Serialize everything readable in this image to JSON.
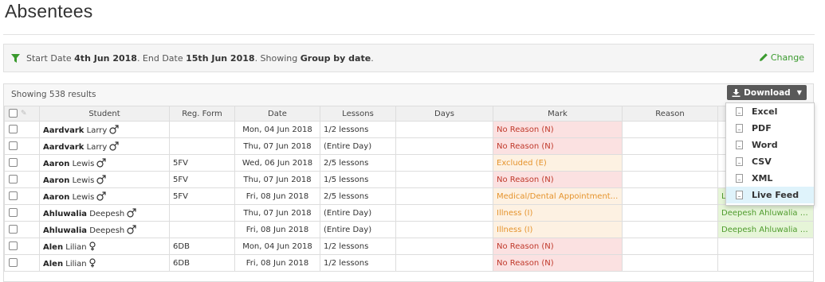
{
  "page": {
    "title": "Absentees"
  },
  "filter": {
    "prefix": "Start Date ",
    "start_date": "4th Jun 2018",
    "mid": ". End Date ",
    "end_date": "15th Jun 2018",
    "mid2": ". Showing ",
    "grouping": "Group by date",
    "suffix": ".",
    "change_label": "Change"
  },
  "results": {
    "label": "Showing 538 results"
  },
  "download": {
    "label": "Download",
    "items": [
      {
        "label": "Excel",
        "icon": "excel-file-icon"
      },
      {
        "label": "PDF",
        "icon": "pdf-file-icon"
      },
      {
        "label": "Word",
        "icon": "word-file-icon"
      },
      {
        "label": "CSV",
        "icon": "csv-file-icon"
      },
      {
        "label": "XML",
        "icon": "xml-file-icon"
      },
      {
        "label": "Live Feed",
        "icon": "live-feed-icon"
      }
    ]
  },
  "table": {
    "headers": [
      "Student",
      "Reg. Form",
      "Date",
      "Lessons",
      "Days",
      "Mark",
      "Reason"
    ],
    "rows": [
      {
        "last": "Aardvark",
        "first": "Larry",
        "gender": "male",
        "form": "",
        "date": "Mon, 04 Jun 2018",
        "lessons": "1/2 lessons",
        "days": "",
        "mark": "No Reason (N)",
        "mark_type": "red",
        "reason": "",
        "extra": ""
      },
      {
        "last": "Aardvark",
        "first": "Larry",
        "gender": "male",
        "form": "",
        "date": "Thu, 07 Jun 2018",
        "lessons": "(Entire Day)",
        "days": "",
        "mark": "No Reason (N)",
        "mark_type": "red",
        "reason": "",
        "extra": ""
      },
      {
        "last": "Aaron",
        "first": "Lewis",
        "gender": "male",
        "form": "5FV",
        "date": "Wed, 06 Jun 2018",
        "lessons": "2/5 lessons",
        "days": "",
        "mark": "Excluded (E)",
        "mark_type": "orange",
        "reason": "",
        "extra": ""
      },
      {
        "last": "Aaron",
        "first": "Lewis",
        "gender": "male",
        "form": "5FV",
        "date": "Thu, 07 Jun 2018",
        "lessons": "1/5 lessons",
        "days": "",
        "mark": "No Reason (N)",
        "mark_type": "red",
        "reason": "",
        "extra": ""
      },
      {
        "last": "Aaron",
        "first": "Lewis",
        "gender": "male",
        "form": "5FV",
        "date": "Fri, 08 Jun 2018",
        "lessons": "2/5 lessons",
        "days": "",
        "mark": "Medical/Dental Appointment...",
        "mark_type": "orange",
        "reason": "",
        "extra": "Le"
      },
      {
        "last": "Ahluwalia",
        "first": "Deepesh",
        "gender": "male",
        "form": "",
        "date": "Thu, 07 Jun 2018",
        "lessons": "(Entire Day)",
        "days": "",
        "mark": "Illness (I)",
        "mark_type": "orange",
        "reason": "",
        "extra": "Deepesh Ahluwalia g..."
      },
      {
        "last": "Ahluwalia",
        "first": "Deepesh",
        "gender": "male",
        "form": "",
        "date": "Fri, 08 Jun 2018",
        "lessons": "(Entire Day)",
        "days": "",
        "mark": "Illness (I)",
        "mark_type": "orange",
        "reason": "",
        "extra": "Deepesh Ahluwalia g..."
      },
      {
        "last": "Alen",
        "first": "Lilian",
        "gender": "female",
        "form": "6DB",
        "date": "Mon, 04 Jun 2018",
        "lessons": "1/2 lessons",
        "days": "",
        "mark": "No Reason (N)",
        "mark_type": "red",
        "reason": "",
        "extra": ""
      },
      {
        "last": "Alen",
        "first": "Lilian",
        "gender": "female",
        "form": "6DB",
        "date": "Fri, 08 Jun 2018",
        "lessons": "1/2 lessons",
        "days": "",
        "mark": "No Reason (N)",
        "mark_type": "red",
        "reason": "",
        "extra": ""
      }
    ]
  }
}
